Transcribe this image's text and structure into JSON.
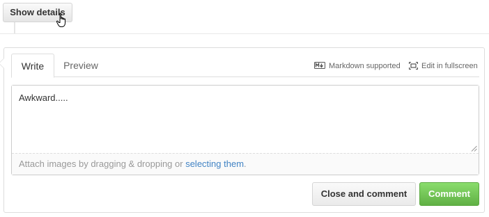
{
  "header": {
    "show_details_label": "Show details"
  },
  "form": {
    "tabs": [
      {
        "label": "Write",
        "active": true
      },
      {
        "label": "Preview",
        "active": false
      }
    ],
    "toolbar": {
      "markdown_label": "Markdown supported",
      "markdown_icon": "markdown-icon",
      "fullscreen_label": "Edit in fullscreen",
      "fullscreen_icon": "fullscreen-icon"
    },
    "textarea": {
      "value": "Awkward....."
    },
    "drag_drop": {
      "text": "Attach images by dragging & dropping or ",
      "link": "selecting them",
      "suffix": "."
    },
    "buttons": {
      "close_label": "Close and comment",
      "comment_label": "Comment"
    }
  },
  "colors": {
    "link": "#4183c4",
    "comment_button": "#6cc644",
    "border": "#dddddd"
  }
}
